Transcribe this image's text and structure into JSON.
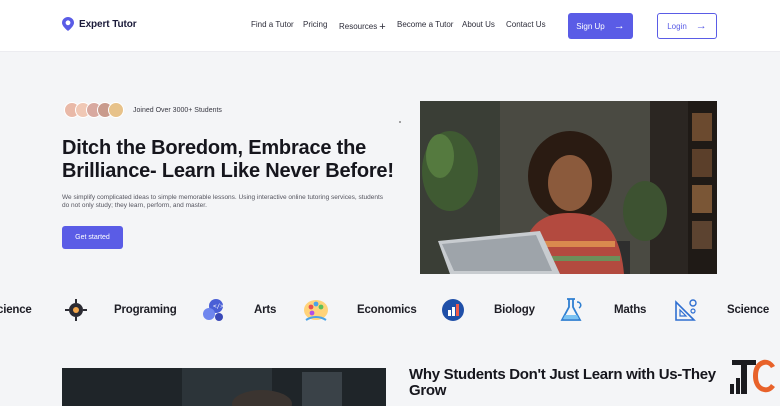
{
  "brand": {
    "name": "Expert Tutor",
    "accent": "#5a5ce6"
  },
  "nav": {
    "items": [
      "Find a Tutor",
      "Pricing",
      "Resources",
      "Become a Tutor",
      "About Us",
      "Contact Us"
    ],
    "resources_icon": "plus-icon",
    "signup_label": "Sign Up",
    "login_label": "Login"
  },
  "hero": {
    "joined_text": "Joined Over 3000+ Students",
    "title": "Ditch the Boredom, Embrace the Brilliance- Learn Like Never Before!",
    "description": "We simplify complicated ideas to simple memorable lessons. Using interactive online tutoring services, students do not only study; they learn, perform, and master.",
    "cta_label": "Get started"
  },
  "subjects": [
    {
      "label": "cience",
      "icon": "science-icon"
    },
    {
      "label": "Programing",
      "icon": "programming-icon"
    },
    {
      "label": "Arts",
      "icon": "arts-palette-icon"
    },
    {
      "label": "Economics",
      "icon": "economics-chart-icon"
    },
    {
      "label": "Biology",
      "icon": "biology-flask-icon"
    },
    {
      "label": "Maths",
      "icon": "maths-geometry-icon"
    },
    {
      "label": "Science",
      "icon": ""
    }
  ],
  "why": {
    "title": "Why Students Don't Just Learn with Us-They Grow"
  }
}
